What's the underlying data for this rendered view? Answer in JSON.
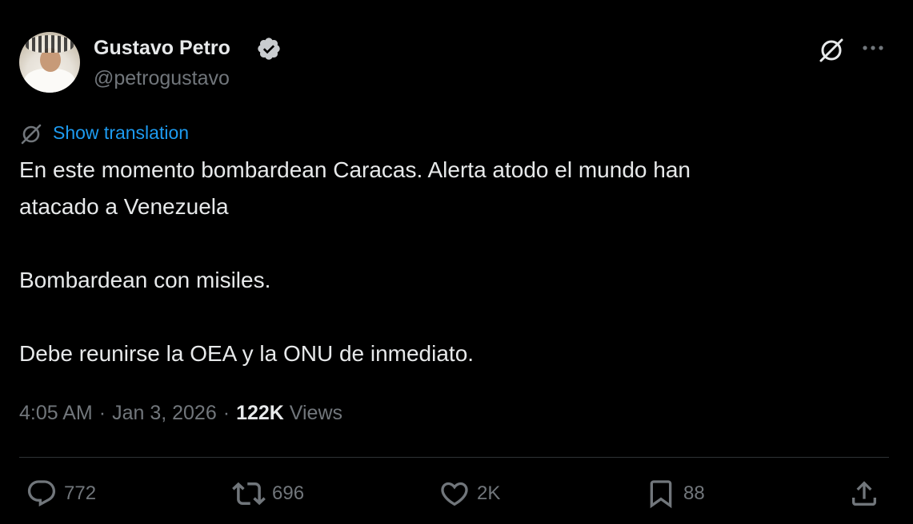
{
  "author": {
    "display_name": "Gustavo Petro",
    "handle": "@petrogustavo",
    "verified": true
  },
  "header_actions": {
    "grok_icon": "grok-icon",
    "more_icon": "more-horizontal-icon"
  },
  "translation": {
    "label": "Show translation",
    "icon": "translate-icon"
  },
  "tweet": {
    "lines": [
      "En este momento bombardean Caracas. Alerta atodo el mundo han",
      "atacado a Venezuela",
      "Bombardean con misiles.",
      "Debe reunirse la OEA y la ONU de inmediato."
    ]
  },
  "meta": {
    "time": "4:05 AM",
    "separator": "·",
    "date": "Jan 3, 2026",
    "views_count": "122K",
    "views_label": "Views"
  },
  "actions": {
    "replies": "772",
    "reposts": "696",
    "likes": "2K",
    "bookmarks": "88"
  },
  "colors": {
    "background": "#000000",
    "text": "#e7e9ea",
    "muted": "#71767b",
    "link": "#1d9bf0",
    "divider": "#2f3336",
    "verified_badge": "#c9cccf"
  }
}
